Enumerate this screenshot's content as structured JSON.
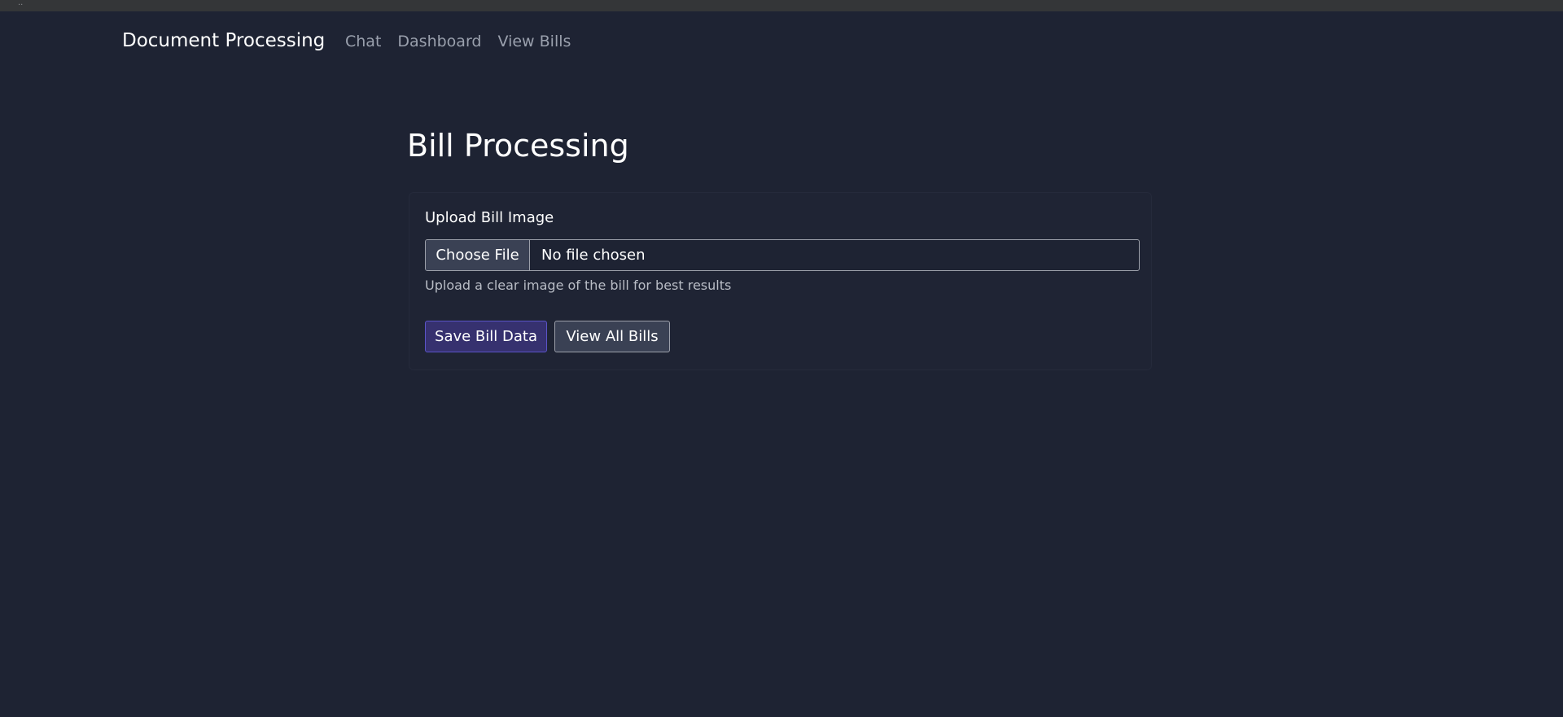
{
  "navbar": {
    "brand": "Document Processing",
    "links": [
      {
        "label": "Chat"
      },
      {
        "label": "Dashboard"
      },
      {
        "label": "View Bills"
      }
    ]
  },
  "page": {
    "title": "Bill Processing"
  },
  "upload_form": {
    "label": "Upload Bill Image",
    "choose_file_label": "Choose File",
    "file_status": "No file chosen",
    "help_text": "Upload a clear image of the bill for best results",
    "save_button_label": "Save Bill Data",
    "view_all_button_label": "View All Bills"
  },
  "colors": {
    "background": "#1e2333",
    "accent": "#36316f"
  }
}
